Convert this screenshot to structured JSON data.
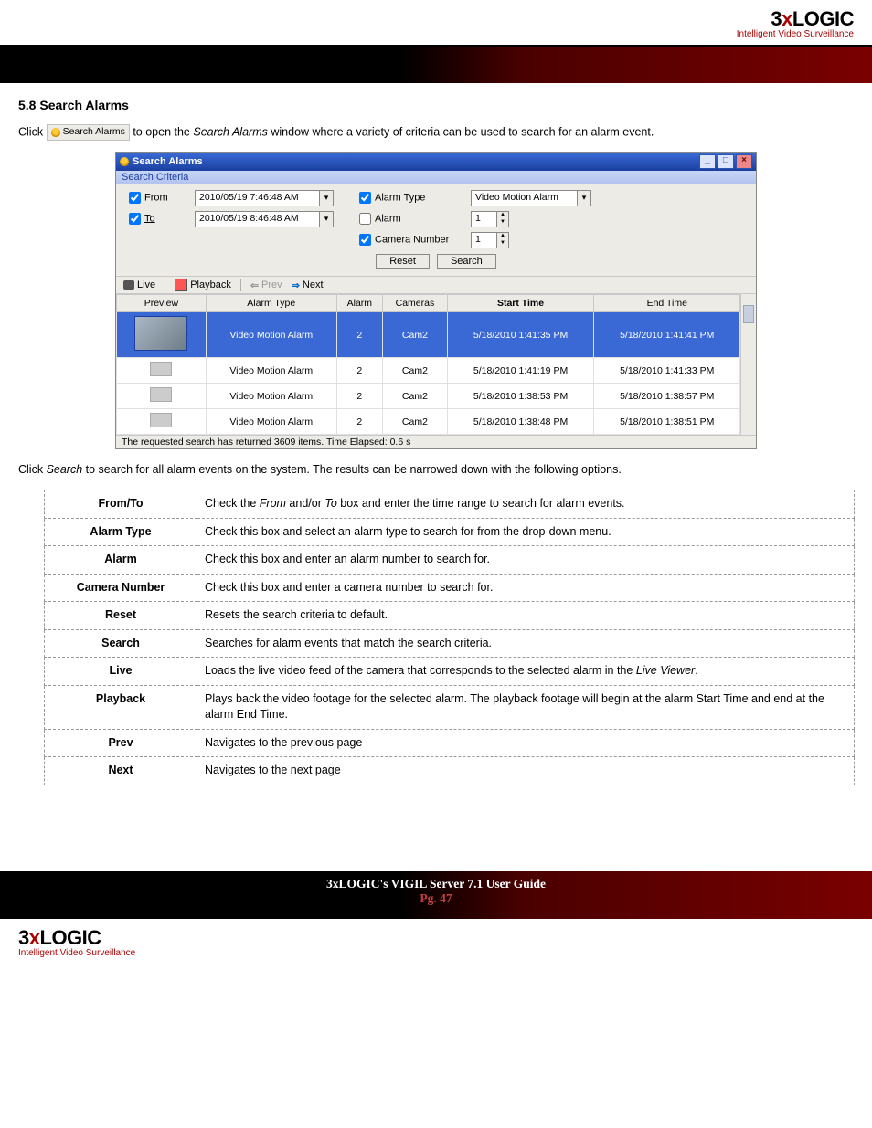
{
  "brand": {
    "three": "3",
    "x": "x",
    "logic": "LOGIC",
    "tagline": "Intelligent Video Surveillance"
  },
  "section": {
    "title": "5.8 Search Alarms",
    "intro_prefix": "Click ",
    "inline_button_label": "Search Alarms",
    "intro_mid": " to open the ",
    "intro_em": "Search Alarms",
    "intro_suffix": " window where a variety of criteria can be used to search for an alarm event.",
    "post_text_prefix": "Click ",
    "post_text_em": "Search",
    "post_text_suffix": " to search for all alarm events on the system.  The results can be narrowed down with the following options."
  },
  "window": {
    "title": "Search Alarms",
    "criteria_title": "Search Criteria",
    "labels": {
      "from": "From",
      "to": "To",
      "alarm_type": "Alarm Type",
      "alarm": "Alarm",
      "camera_number": "Camera Number"
    },
    "from_value": "2010/05/19  7:46:48 AM",
    "to_value": "2010/05/19  8:46:48 AM",
    "alarm_type_value": "Video Motion Alarm",
    "alarm_value": "1",
    "camera_value": "1",
    "checks": {
      "from": true,
      "to": true,
      "alarm_type": true,
      "alarm": false,
      "camera_number": true
    },
    "buttons": {
      "reset": "Reset",
      "search": "Search"
    },
    "toolbar": {
      "live": "Live",
      "playback": "Playback",
      "prev": "Prev",
      "next": "Next"
    },
    "columns": {
      "preview": "Preview",
      "alarm_type": "Alarm Type",
      "alarm": "Alarm",
      "cameras": "Cameras",
      "start_time": "Start Time",
      "end_time": "End Time"
    },
    "rows": [
      {
        "alarm_type": "Video Motion Alarm",
        "alarm": "2",
        "cameras": "Cam2",
        "start": "5/18/2010 1:41:35 PM",
        "end": "5/18/2010 1:41:41 PM",
        "selected": true
      },
      {
        "alarm_type": "Video Motion Alarm",
        "alarm": "2",
        "cameras": "Cam2",
        "start": "5/18/2010 1:41:19 PM",
        "end": "5/18/2010 1:41:33 PM",
        "selected": false
      },
      {
        "alarm_type": "Video Motion Alarm",
        "alarm": "2",
        "cameras": "Cam2",
        "start": "5/18/2010 1:38:53 PM",
        "end": "5/18/2010 1:38:57 PM",
        "selected": false
      },
      {
        "alarm_type": "Video Motion Alarm",
        "alarm": "2",
        "cameras": "Cam2",
        "start": "5/18/2010 1:38:48 PM",
        "end": "5/18/2010 1:38:51 PM",
        "selected": false
      }
    ],
    "status": "The requested search has returned 3609 items.  Time Elapsed: 0.6 s"
  },
  "options": [
    {
      "label": "From/To",
      "desc_pre": "Check the ",
      "desc_em1": "From",
      "desc_mid": " and/or ",
      "desc_em2": "To",
      "desc_post": " box and enter the time range to search for alarm events."
    },
    {
      "label": "Alarm Type",
      "desc": "Check this box and select an alarm type to search for from the drop-down menu."
    },
    {
      "label": "Alarm",
      "desc": "Check this box and enter an alarm number to search for."
    },
    {
      "label": "Camera Number",
      "desc": "Check this box and enter a camera number to search for."
    },
    {
      "label": "Reset",
      "desc": "Resets the search criteria to default."
    },
    {
      "label": "Search",
      "desc": "Searches for alarm events that match the search criteria."
    },
    {
      "label": "Live",
      "desc_pre": "Loads the live video feed of the camera that corresponds to the selected alarm in the ",
      "desc_em1": "Live Viewer",
      "desc_post": "."
    },
    {
      "label": "Playback",
      "desc": "Plays back the video footage for the selected alarm. The playback footage will begin at the alarm Start Time and end at the alarm End Time."
    },
    {
      "label": "Prev",
      "desc": "Navigates to the previous page"
    },
    {
      "label": "Next",
      "desc": "Navigates to the next page"
    }
  ],
  "footer": {
    "title": "3xLOGIC's VIGIL Server 7.1 User Guide",
    "page": "Pg. 47"
  }
}
